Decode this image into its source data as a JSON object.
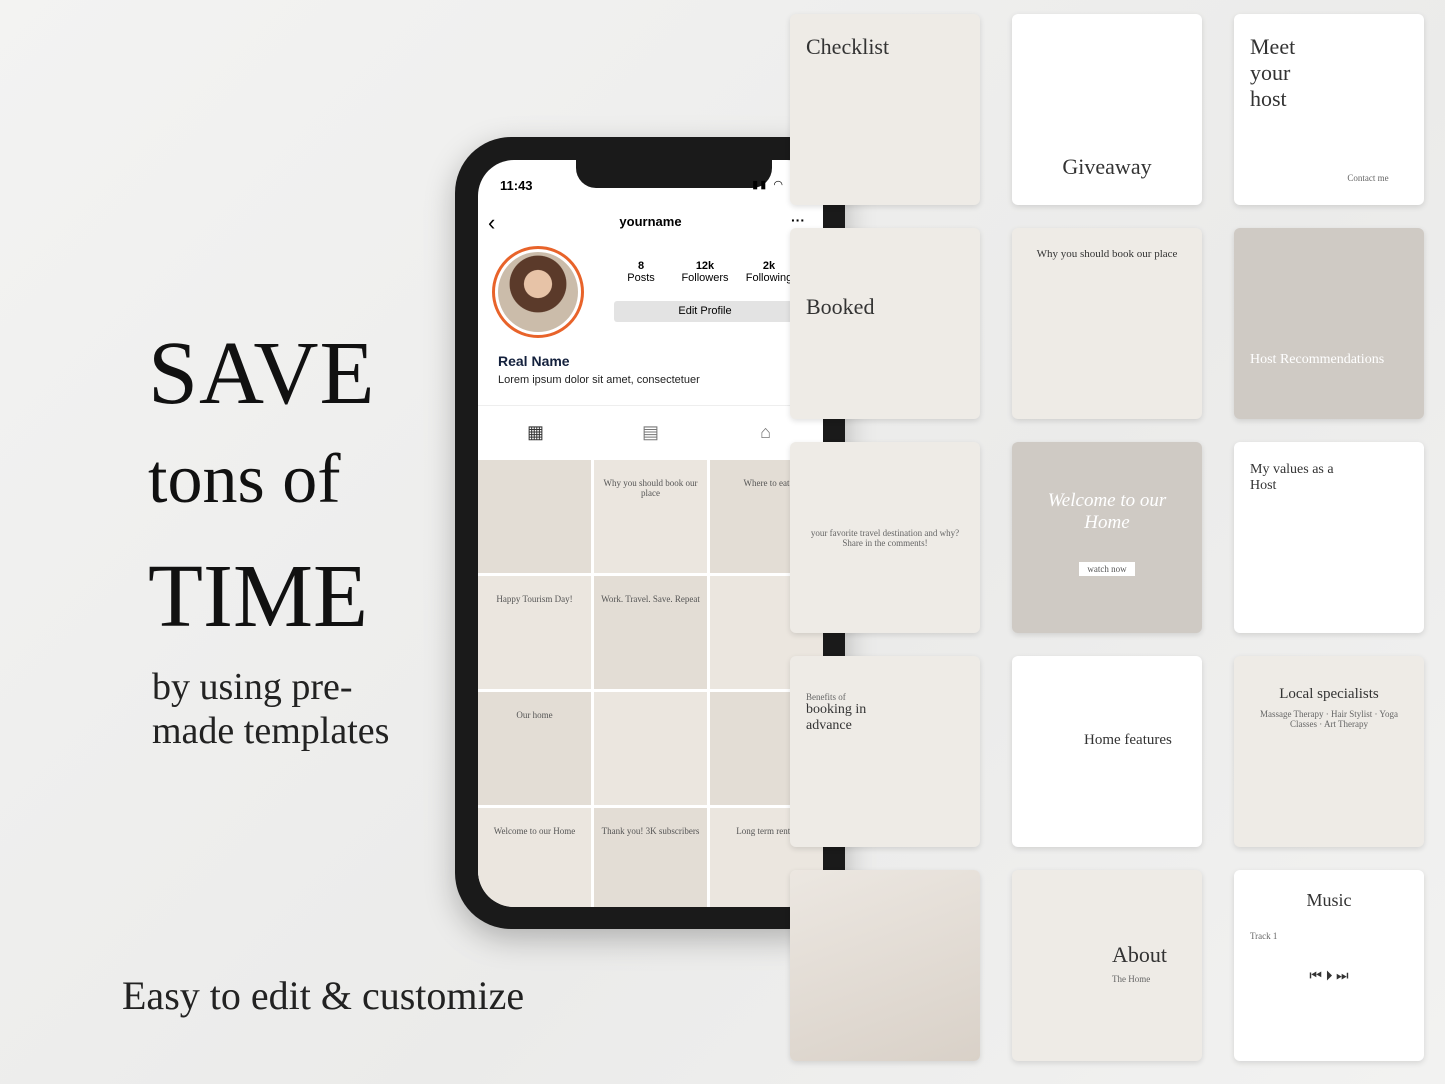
{
  "headline": {
    "line1": "SAVE",
    "line2": "tons of",
    "line3": "TIME",
    "line4": "by using pre-made templates",
    "tagline": "Easy to edit & customize"
  },
  "phone": {
    "time": "11:43",
    "username": "yourname",
    "stats": [
      {
        "value": "8",
        "label": "Posts"
      },
      {
        "value": "12k",
        "label": "Followers"
      },
      {
        "value": "2k",
        "label": "Following"
      }
    ],
    "edit_label": "Edit Profile",
    "real_name": "Real Name",
    "bio": "Lorem ipsum dolor sit amet, consectetuer",
    "posts": [
      "",
      "Why you should book our place",
      "Where to eat",
      "Happy Tourism Day!",
      "Work. Travel. Save. Repeat",
      "",
      "Our home",
      "",
      "",
      "Welcome to our Home",
      "Thank you! 3K subscribers",
      "Long term rental"
    ]
  },
  "cards": [
    {
      "title": "Checklist",
      "sub": ""
    },
    {
      "title": "Giveaway",
      "sub": ""
    },
    {
      "title": "Meet your host",
      "sub": "Contact me"
    },
    {
      "title": "Booked",
      "sub": ""
    },
    {
      "title": "Why you should book our place",
      "sub": ""
    },
    {
      "title": "Host Recommendations",
      "sub": ""
    },
    {
      "title": "",
      "sub": "your favorite travel destination and why? Share in the comments!"
    },
    {
      "title": "Welcome to our Home",
      "sub": "watch now"
    },
    {
      "title": "My values as a Host",
      "sub": ""
    },
    {
      "title": "booking in advance",
      "sub": "Benefits of"
    },
    {
      "title": "Home features",
      "sub": ""
    },
    {
      "title": "Local specialists",
      "sub": "Massage Therapy · Hair Stylist · Yoga Classes · Art Therapy"
    },
    {
      "title": "",
      "sub": ""
    },
    {
      "title": "About",
      "sub": "The Home"
    },
    {
      "title": "Music",
      "sub": "Track 1"
    }
  ]
}
